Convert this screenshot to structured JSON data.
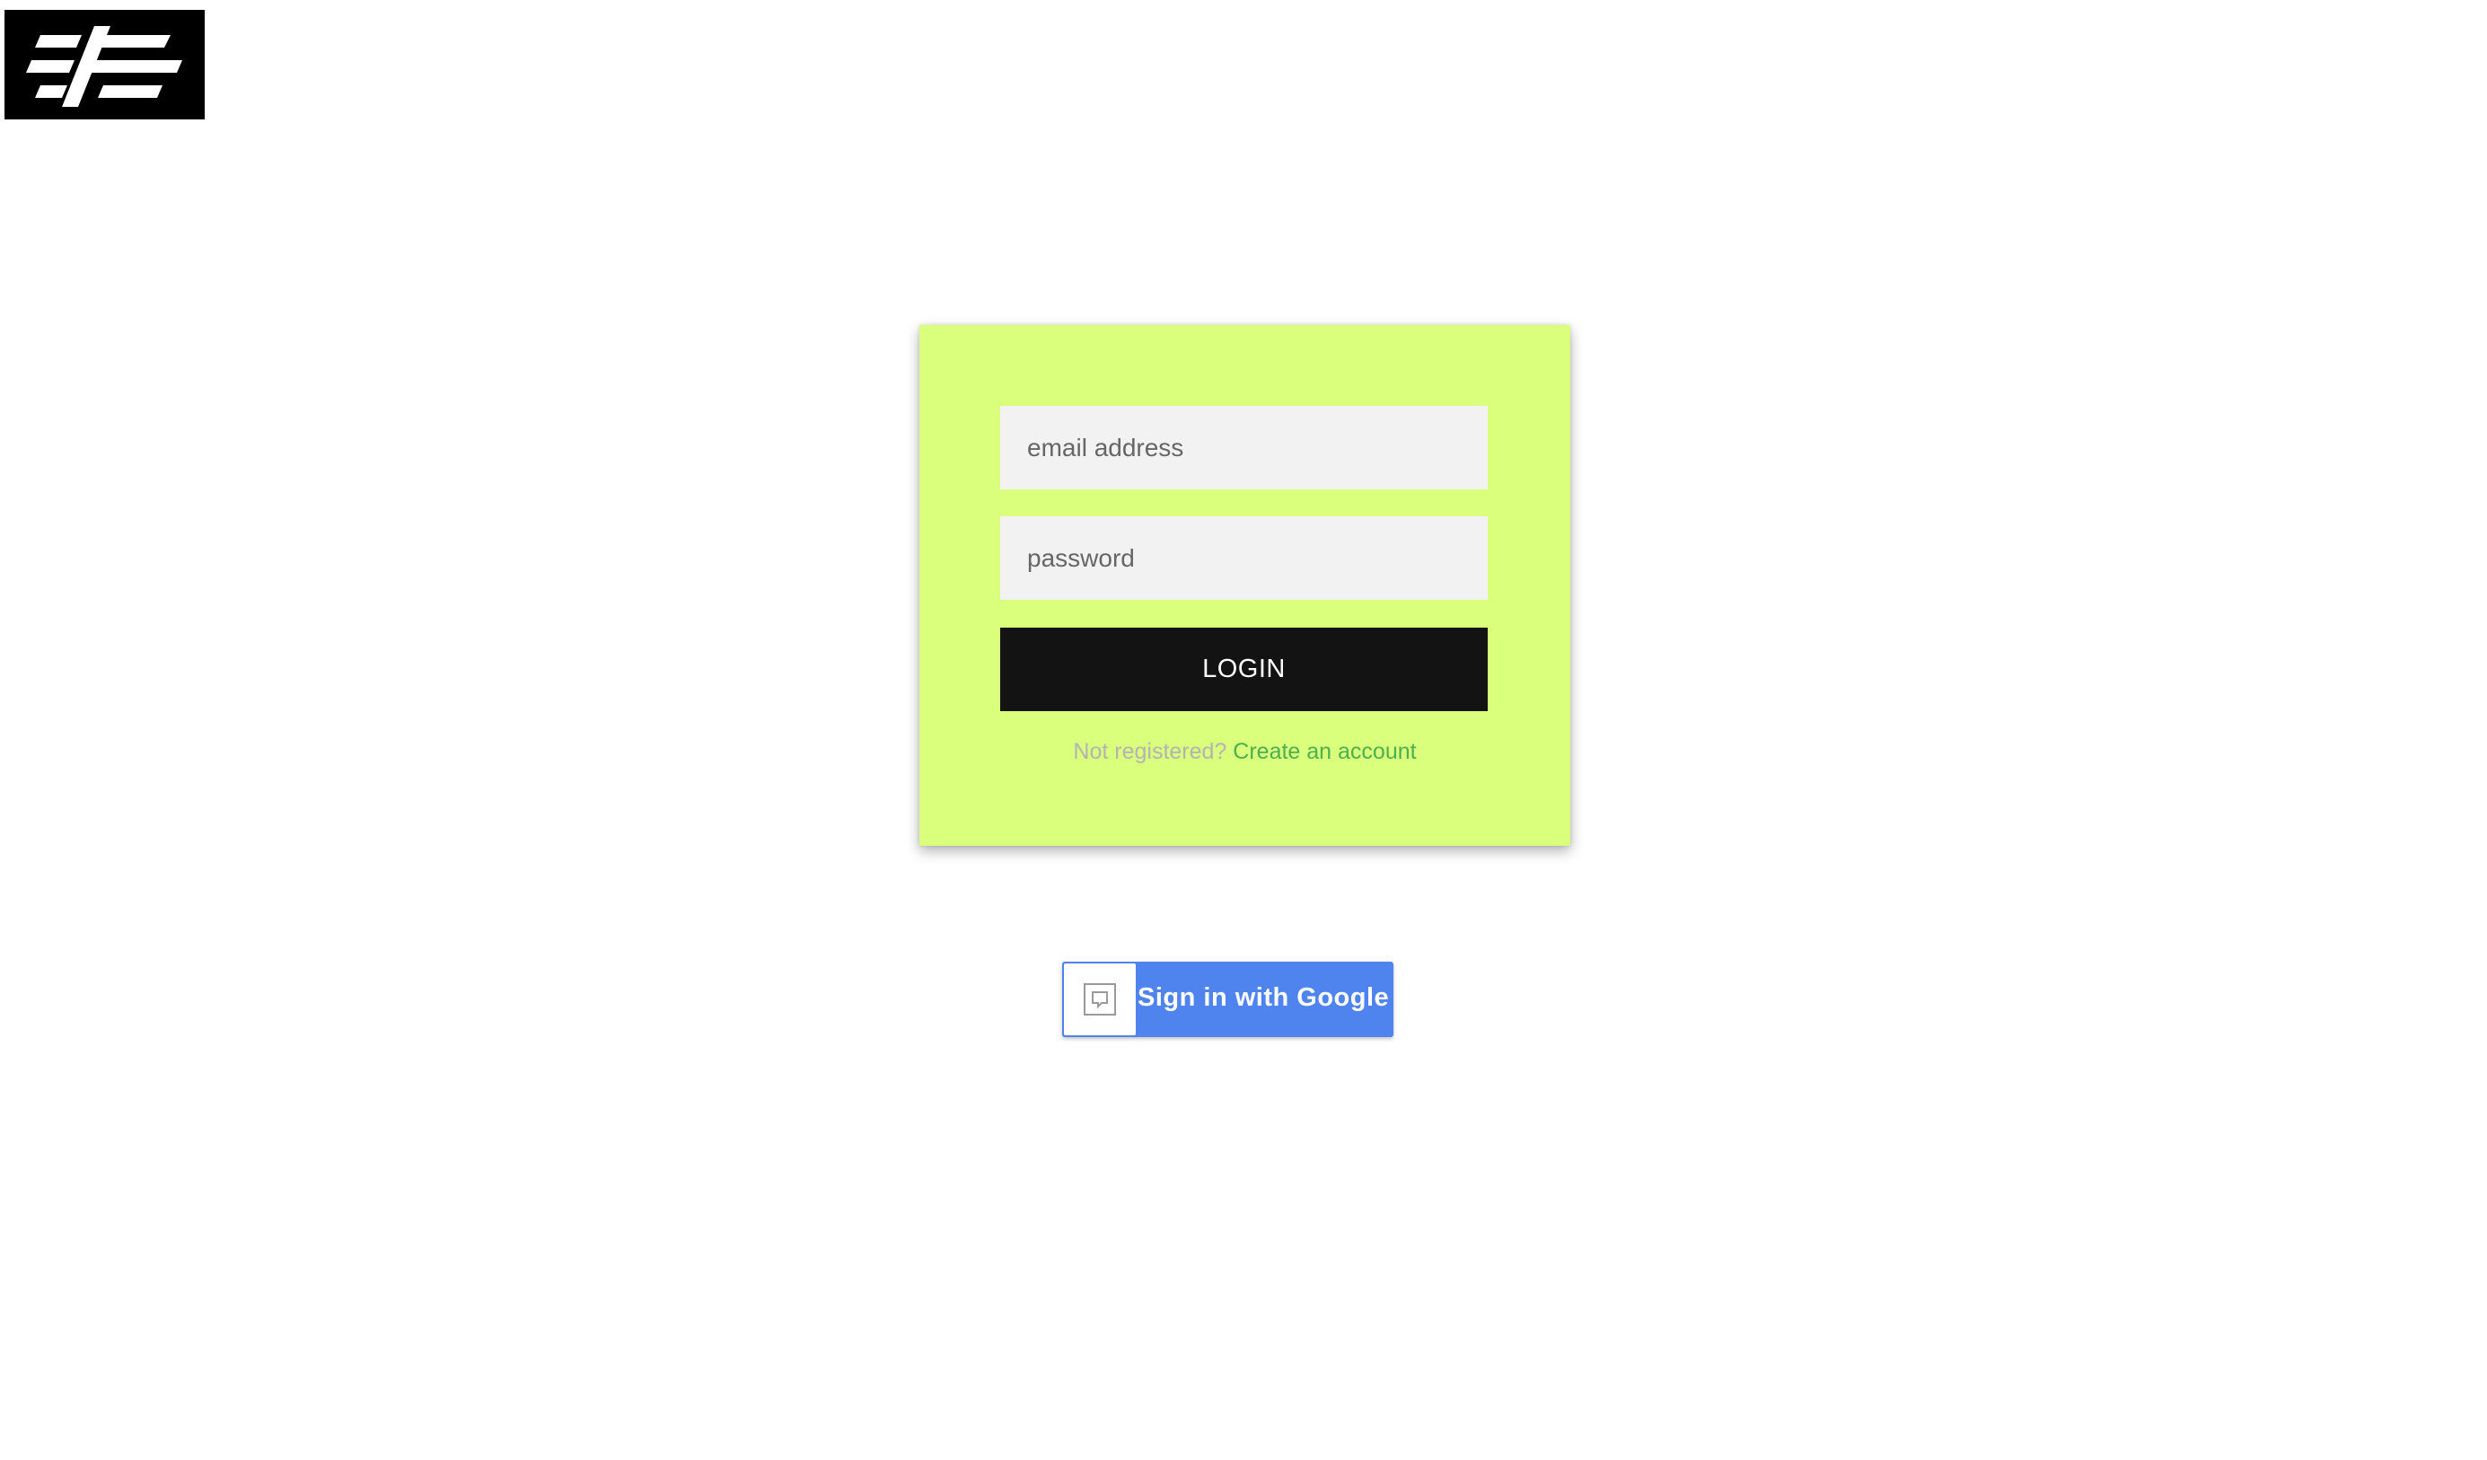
{
  "brand": {
    "logo_icon": "brand-logo-icon",
    "logo_background": "#000000"
  },
  "login_form": {
    "background": "#daff7d",
    "email_placeholder": "email address",
    "email_value": "",
    "password_placeholder": "password",
    "password_value": "",
    "login_label": "LOGIN",
    "register_prompt": "Not registered?",
    "register_link": "Create an account",
    "link_color": "#4caf50"
  },
  "google_signin": {
    "label": "Sign in with Google",
    "icon": "broken-image-icon",
    "background": "#4f84ee"
  }
}
